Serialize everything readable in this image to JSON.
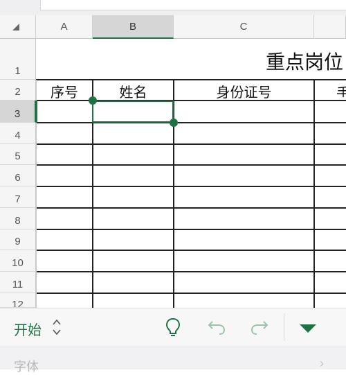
{
  "columns": [
    {
      "id": "A",
      "label": "A"
    },
    {
      "id": "B",
      "label": "B",
      "selected": true
    },
    {
      "id": "C",
      "label": "C"
    }
  ],
  "rows": [
    "1",
    "2",
    "3",
    "4",
    "5",
    "6",
    "7",
    "8",
    "9",
    "10",
    "11",
    "12"
  ],
  "selected_row": "3",
  "sheet": {
    "title": "重点岗位",
    "headers": [
      "序号",
      "姓名",
      "身份证号"
    ]
  },
  "toolbar": {
    "tab_label": "开始",
    "icons": [
      "lightbulb-icon",
      "undo-icon",
      "redo-icon",
      "collapse-triangle-icon"
    ]
  },
  "subbar": {
    "label": "字体"
  },
  "colors": {
    "accent": "#1f7244",
    "header_bg": "#f5f5f5",
    "selected_header_bg": "#d6d6d6"
  }
}
